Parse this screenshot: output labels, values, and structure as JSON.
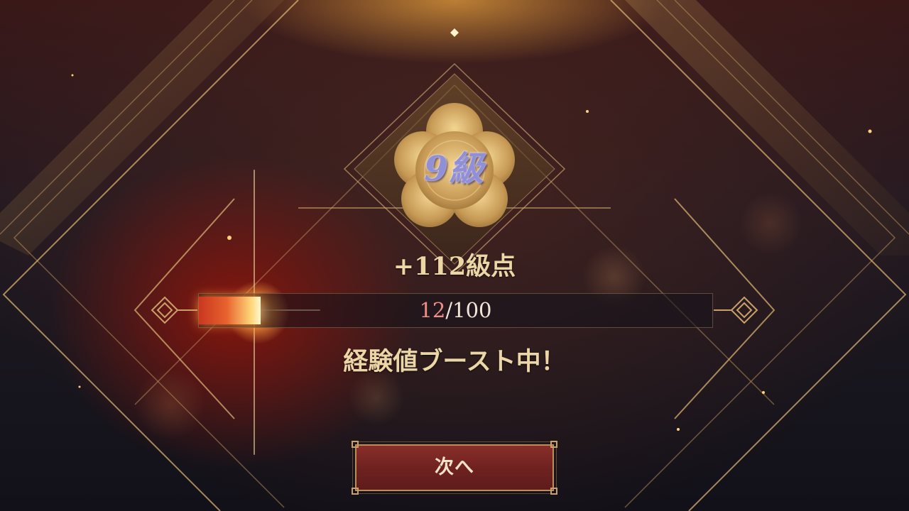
{
  "result": {
    "grade_title": "9級",
    "points_gained": "+112級点",
    "progress_current": "12",
    "progress_separator": "/",
    "progress_max": "100",
    "progress_fraction": 0.12,
    "boost_message": "経験値ブースト中！"
  },
  "buttons": {
    "next_label": "次へ"
  },
  "icons": {
    "emblem": "plum-blossom-emblem",
    "ornament_left": "knot-ornament",
    "ornament_right": "knot-ornament"
  },
  "colors": {
    "gold": "#ecd6a6",
    "grade_text": "#8f90d8",
    "progress_current": "#ef8e86",
    "button_red": "#6f2220"
  }
}
